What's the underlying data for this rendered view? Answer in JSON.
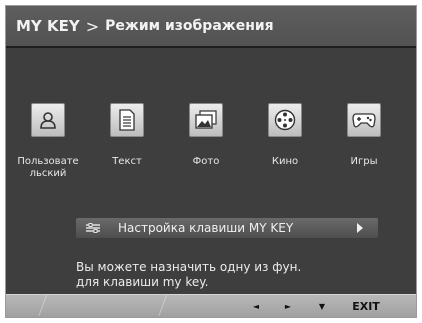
{
  "header": {
    "menu": "MY KEY",
    "separator": ">",
    "title": "Режим изображения"
  },
  "modes": [
    {
      "id": "user",
      "label": "Пользовате льский",
      "icon": "user-icon"
    },
    {
      "id": "text",
      "label": "Текст",
      "icon": "document-icon"
    },
    {
      "id": "photo",
      "label": "Фото",
      "icon": "photo-icon"
    },
    {
      "id": "cinema",
      "label": "Кино",
      "icon": "film-reel-icon"
    },
    {
      "id": "game",
      "label": "Игры",
      "icon": "gamepad-icon"
    }
  ],
  "hotkey": {
    "label": "Настройка клавиши MY KEY",
    "icon": "settings-icon",
    "arrow": "chevron-right-icon"
  },
  "description": {
    "line1": "Вы можете назначить одну из фун.",
    "line2": "для клавиши my key."
  },
  "footer": {
    "left": "◄",
    "right": "►",
    "down": "▼",
    "exit": "EXIT"
  },
  "colors": {
    "panel": "#3e3e3e",
    "header": "#575757",
    "footer": "#aaaaaa",
    "tile": "#dcdcdc"
  }
}
